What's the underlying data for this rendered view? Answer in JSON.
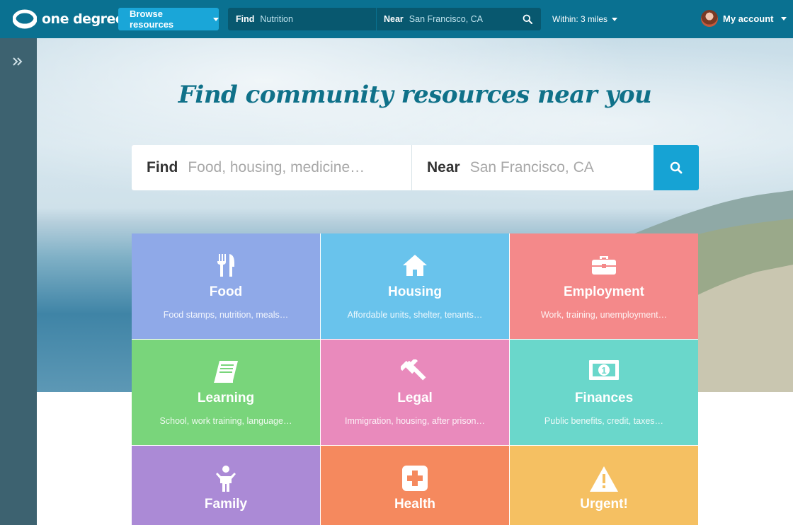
{
  "brand": {
    "name": "one degree"
  },
  "topbar": {
    "browse_label": "Browse resources",
    "find_label": "Find",
    "find_value": "Nutrition",
    "near_label": "Near",
    "near_value": "San Francisco, CA",
    "within_label": "Within: 3 miles",
    "account_label": "My account"
  },
  "hero": {
    "title": "Find community resources near you",
    "find_label": "Find",
    "find_placeholder": "Food, housing, medicine…",
    "near_label": "Near",
    "near_placeholder": "San Francisco, CA"
  },
  "categories": [
    {
      "title": "Food",
      "desc": "Food stamps, nutrition, meals…",
      "color": "#8fa9e8",
      "icon": "fork-knife-icon"
    },
    {
      "title": "Housing",
      "desc": "Affordable units, shelter, tenants…",
      "color": "#69c3ec",
      "icon": "house-icon"
    },
    {
      "title": "Employment",
      "desc": "Work, training, unemployment…",
      "color": "#f4898a",
      "icon": "briefcase-icon"
    },
    {
      "title": "Learning",
      "desc": "School, work training, language…",
      "color": "#79d57b",
      "icon": "book-icon"
    },
    {
      "title": "Legal",
      "desc": "Immigration, housing, after prison…",
      "color": "#e98abc",
      "icon": "gavel-icon"
    },
    {
      "title": "Finances",
      "desc": "Public benefits, credit, taxes…",
      "color": "#6ad7cb",
      "icon": "money-icon"
    },
    {
      "title": "Family",
      "desc": "",
      "color": "#ab8ad6",
      "icon": "child-icon"
    },
    {
      "title": "Health",
      "desc": "",
      "color": "#f5895e",
      "icon": "medical-cross-icon"
    },
    {
      "title": "Urgent!",
      "desc": "",
      "color": "#f5c062",
      "icon": "warning-icon"
    }
  ],
  "colors": {
    "topbar": "#0a7191",
    "sidebar": "#3d6270",
    "accent": "#16a3d4",
    "title": "#0f7189"
  }
}
